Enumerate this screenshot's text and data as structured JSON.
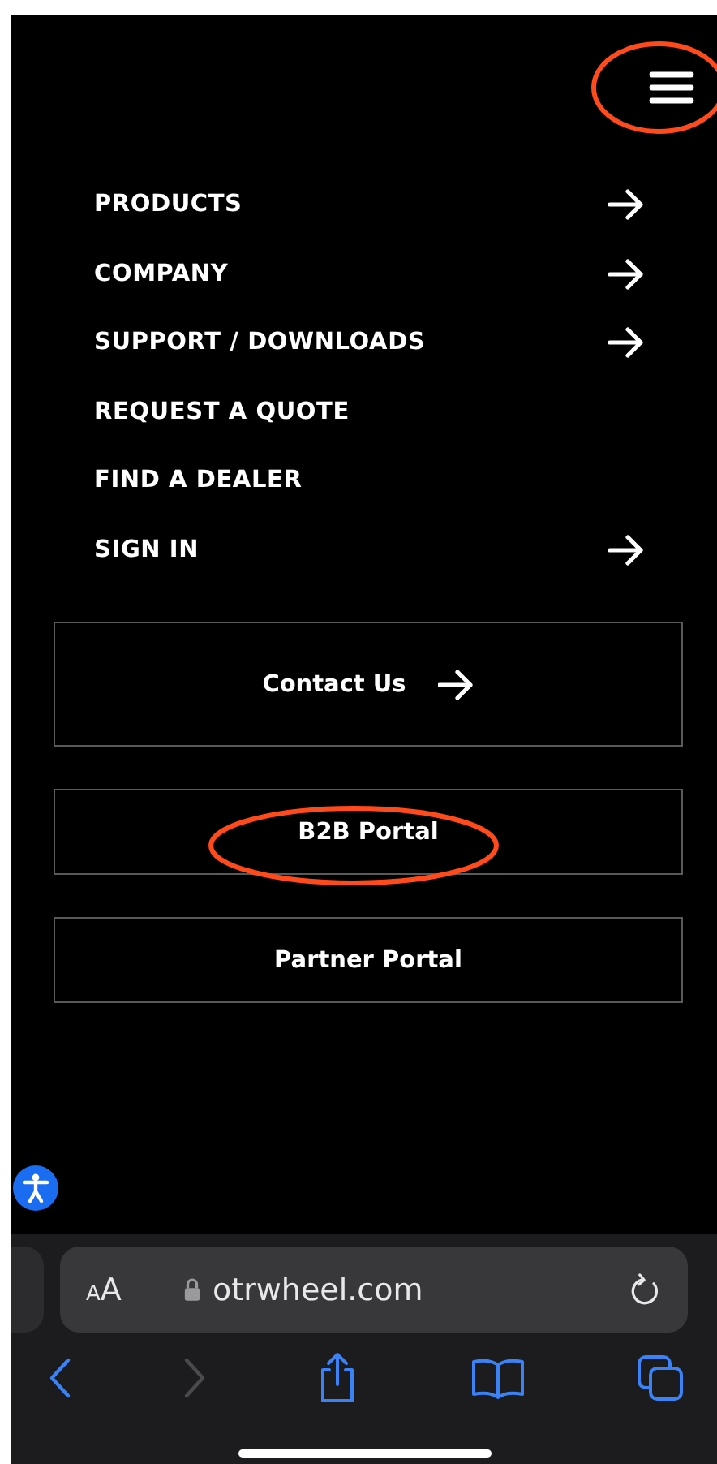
{
  "header": {
    "menu_button": {
      "circled": true
    }
  },
  "menu": [
    {
      "label": "PRODUCTS",
      "has_arrow": true
    },
    {
      "label": "COMPANY",
      "has_arrow": true
    },
    {
      "label": "SUPPORT / DOWNLOADS",
      "has_arrow": true
    },
    {
      "label": "REQUEST A QUOTE",
      "has_arrow": false
    },
    {
      "label": "FIND A DEALER",
      "has_arrow": false
    },
    {
      "label": "SIGN IN",
      "has_arrow": true
    }
  ],
  "buttons": [
    {
      "kind": "contact",
      "label": "Contact Us",
      "has_arrow": true,
      "circled": false
    },
    {
      "kind": "portal",
      "label": "B2B Portal",
      "has_arrow": false,
      "circled": true
    },
    {
      "kind": "portal",
      "label": "Partner Portal",
      "has_arrow": false,
      "circled": false
    }
  ],
  "browser": {
    "text_size_button": "AA",
    "url": "otrwheel.com",
    "secure": true,
    "toolbar": [
      {
        "kind": "back",
        "disabled": false
      },
      {
        "kind": "forward",
        "disabled": true
      },
      {
        "kind": "share",
        "disabled": false
      },
      {
        "kind": "bookmarks",
        "disabled": false
      },
      {
        "kind": "tabs",
        "disabled": false
      }
    ]
  }
}
